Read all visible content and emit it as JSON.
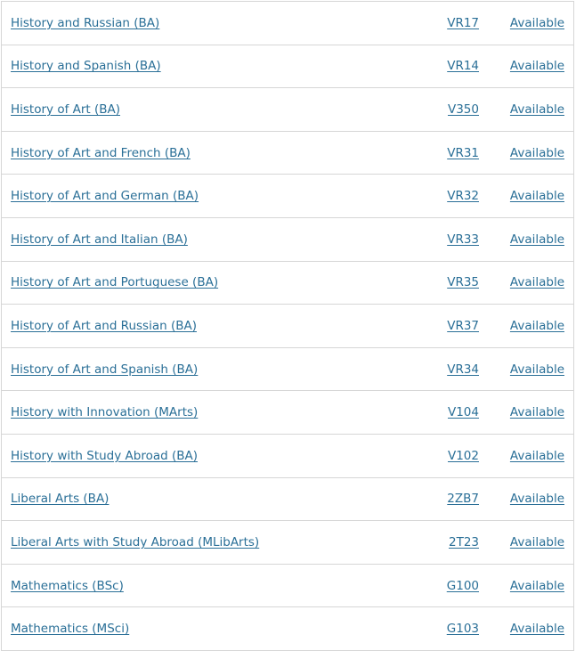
{
  "courses": [
    {
      "name": "History and Russian (BA)",
      "code": "VR17",
      "status": "Available"
    },
    {
      "name": "History and Spanish (BA)",
      "code": "VR14",
      "status": "Available"
    },
    {
      "name": "History of Art (BA)",
      "code": "V350",
      "status": "Available"
    },
    {
      "name": "History of Art and French (BA)",
      "code": "VR31",
      "status": "Available"
    },
    {
      "name": "History of Art and German (BA)",
      "code": "VR32",
      "status": "Available"
    },
    {
      "name": "History of Art and Italian (BA)",
      "code": "VR33",
      "status": "Available"
    },
    {
      "name": "History of Art and Portuguese (BA)",
      "code": "VR35",
      "status": "Available"
    },
    {
      "name": "History of Art and Russian (BA)",
      "code": "VR37",
      "status": "Available"
    },
    {
      "name": "History of Art and Spanish (BA)",
      "code": "VR34",
      "status": "Available"
    },
    {
      "name": "History with Innovation (MArts)",
      "code": "V104",
      "status": "Available"
    },
    {
      "name": "History with Study Abroad (BA)",
      "code": "V102",
      "status": "Available"
    },
    {
      "name": "Liberal Arts (BA)",
      "code": "2ZB7",
      "status": "Available"
    },
    {
      "name": "Liberal Arts with Study Abroad (MLibArts)",
      "code": "2T23",
      "status": "Available"
    },
    {
      "name": "Mathematics (BSc)",
      "code": "G100",
      "status": "Available"
    },
    {
      "name": "Mathematics (MSci)",
      "code": "G103",
      "status": "Available"
    }
  ],
  "colors": {
    "link": "#2a6f97",
    "border": "#d6d6d6"
  }
}
